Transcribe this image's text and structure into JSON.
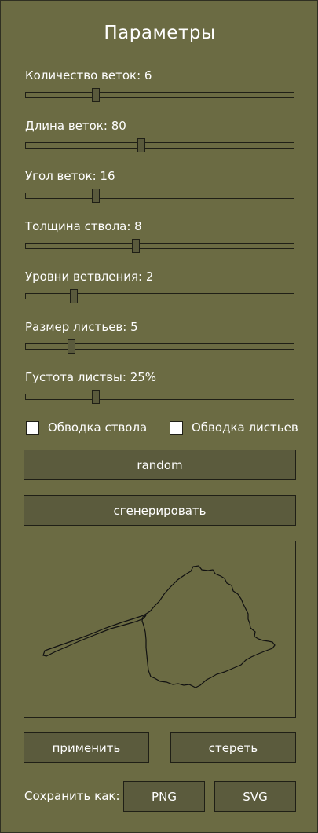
{
  "panel": {
    "title": "Параметры"
  },
  "sliders": [
    {
      "label": "Количество веток: 6",
      "fraction": 0.26
    },
    {
      "label": "Длина веток: 80",
      "fraction": 0.43
    },
    {
      "label": "Угол веток: 16",
      "fraction": 0.26
    },
    {
      "label": "Толщина ствола: 8",
      "fraction": 0.41
    },
    {
      "label": "Уровни ветвления: 2",
      "fraction": 0.18
    },
    {
      "label": "Размер листьев: 5",
      "fraction": 0.17
    },
    {
      "label": "Густота листвы: 25%",
      "fraction": 0.26
    }
  ],
  "checkboxes": {
    "trunk_outline": {
      "label": "Обводка ствола",
      "checked": false
    },
    "leaf_outline": {
      "label": "Обводка листьев",
      "checked": false
    }
  },
  "buttons": {
    "random": "random",
    "generate": "сгенерировать",
    "apply": "применить",
    "erase": "стереть",
    "png": "PNG",
    "svg": "SVG"
  },
  "save": {
    "label": "Сохранить как:"
  },
  "colors": {
    "background": "#6b6b43",
    "button": "#5b5b3d",
    "border": "#1f1f16",
    "text": "#ffffff"
  }
}
